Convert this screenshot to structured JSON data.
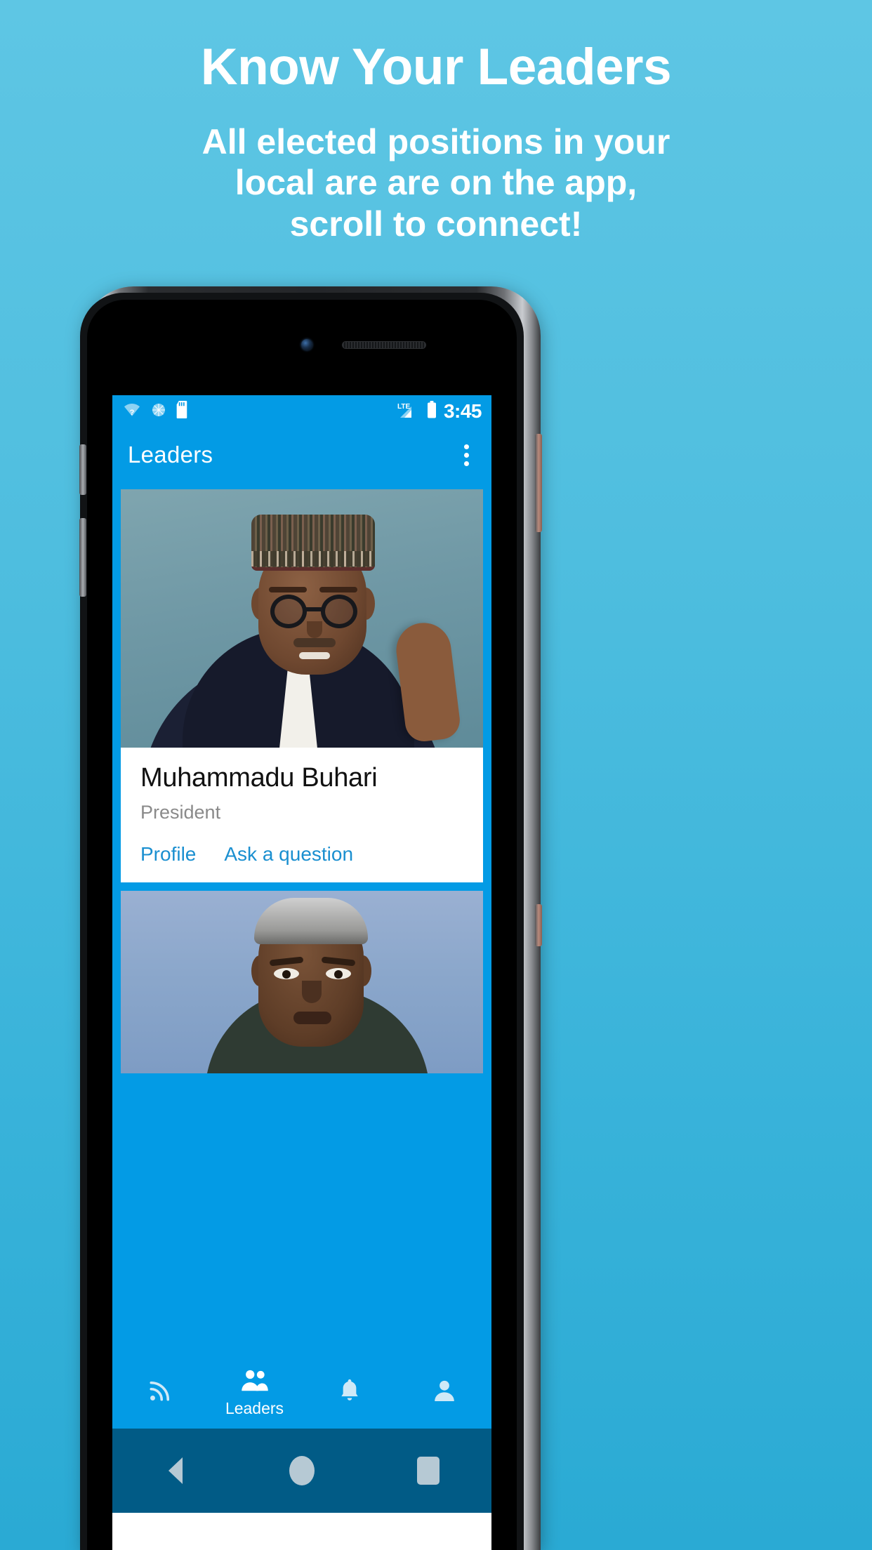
{
  "promo": {
    "title": "Know Your Leaders",
    "subtitle_lines": [
      "All elected positions in your",
      "local are are on the app,",
      "scroll to connect!"
    ],
    "background_color": "#4fbedf",
    "text_color": "#ffffff"
  },
  "phone": {
    "device_color": "#2b2d30",
    "screen_background": "#ffffff"
  },
  "statusbar": {
    "time": "3:45",
    "network_type": "LTE",
    "icons": [
      "wifi-no-internet-icon",
      "sync-icon",
      "sd-card-icon"
    ],
    "right_icons": [
      "lte-signal-icon",
      "battery-full-icon"
    ],
    "background_color": "#039be5"
  },
  "appbar": {
    "title": "Leaders",
    "overflow_icon": "overflow-menu-icon",
    "background_color": "#039be5",
    "text_color": "#ffffff"
  },
  "cards": [
    {
      "photo_alt": "portrait-photo",
      "name": "Muhammadu Buhari",
      "role": "President",
      "actions": [
        {
          "label": "Profile",
          "name": "profile-action"
        },
        {
          "label": "Ask a question",
          "name": "ask-question-action"
        }
      ],
      "action_color": "#1a8fd0"
    },
    {
      "photo_alt": "portrait-photo-2"
    }
  ],
  "bottomnav": {
    "background_color": "#039be5",
    "items": [
      {
        "icon": "feed-rss-icon",
        "label": "",
        "active": false
      },
      {
        "icon": "people-group-icon",
        "label": "Leaders",
        "active": true
      },
      {
        "icon": "bell-notifications-icon",
        "label": "",
        "active": false
      },
      {
        "icon": "person-profile-icon",
        "label": "",
        "active": false
      }
    ]
  },
  "sysnav": {
    "background_color": "#015b86",
    "buttons": [
      {
        "icon": "android-back-icon"
      },
      {
        "icon": "android-home-icon"
      },
      {
        "icon": "android-recents-icon"
      }
    ]
  }
}
